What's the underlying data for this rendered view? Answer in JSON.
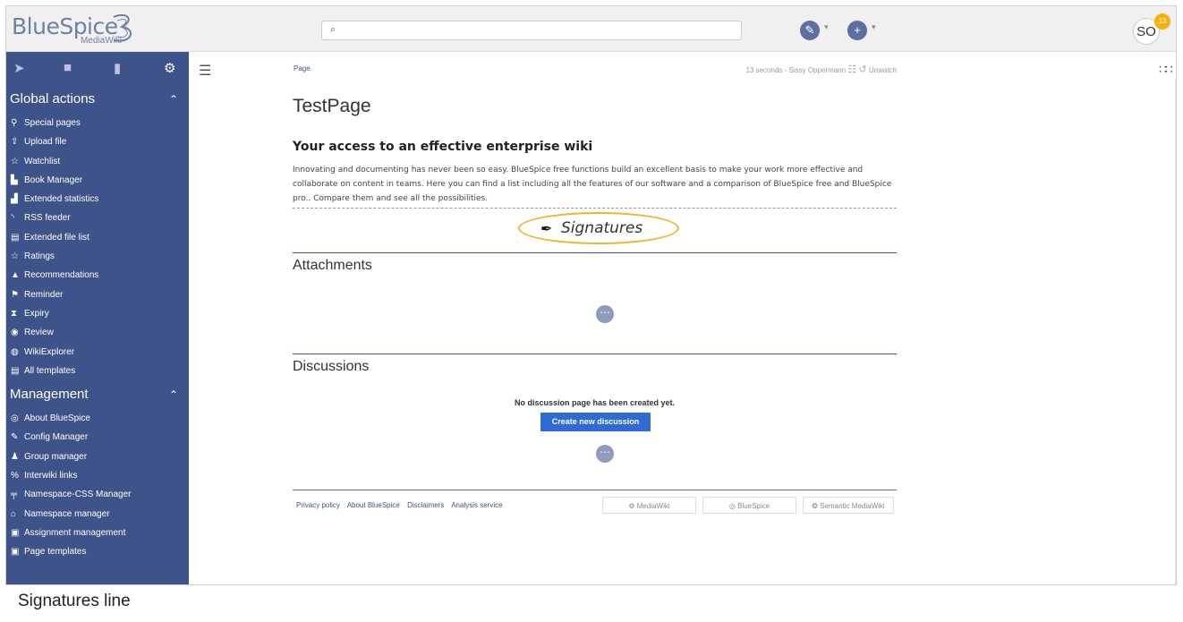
{
  "header": {
    "logo_main": "BlueSpice",
    "logo_sub": "MediaWiki",
    "search_placeholder": "",
    "avatar_initials": "SO",
    "notification_count": "13"
  },
  "sidebar": {
    "sections": [
      {
        "title": "Global actions",
        "items": [
          {
            "icon": "special-pages-icon",
            "glyph": "⚲",
            "label": "Special pages"
          },
          {
            "icon": "upload-icon",
            "glyph": "⇪",
            "label": "Upload file"
          },
          {
            "icon": "star-icon",
            "glyph": "☆",
            "label": "Watchlist"
          },
          {
            "icon": "book-icon",
            "glyph": "▙",
            "label": "Book Manager"
          },
          {
            "icon": "chart-icon",
            "glyph": "▟",
            "label": "Extended statistics"
          },
          {
            "icon": "rss-icon",
            "glyph": "◝",
            "label": "RSS feeder"
          },
          {
            "icon": "file-list-icon",
            "glyph": "▤",
            "label": "Extended file list"
          },
          {
            "icon": "star-icon",
            "glyph": "☆",
            "label": "Ratings"
          },
          {
            "icon": "thumbs-up-icon",
            "glyph": "▲",
            "label": "Recommendations"
          },
          {
            "icon": "flag-icon",
            "glyph": "⚑",
            "label": "Reminder"
          },
          {
            "icon": "hourglass-icon",
            "glyph": "⧗",
            "label": "Expiry"
          },
          {
            "icon": "eye-icon",
            "glyph": "◉",
            "label": "Review"
          },
          {
            "icon": "globe-icon",
            "glyph": "◍",
            "label": "WikiExplorer"
          },
          {
            "icon": "template-icon",
            "glyph": "▤",
            "label": "All templates"
          }
        ]
      },
      {
        "title": "Management",
        "items": [
          {
            "icon": "info-icon",
            "glyph": "◎",
            "label": "About BlueSpice"
          },
          {
            "icon": "wrench-icon",
            "glyph": "✎",
            "label": "Config Manager"
          },
          {
            "icon": "group-icon",
            "glyph": "♟",
            "label": "Group manager"
          },
          {
            "icon": "link-icon",
            "glyph": "%",
            "label": "Interwiki links"
          },
          {
            "icon": "paint-icon",
            "glyph": "╤",
            "label": "Namespace-CSS Manager"
          },
          {
            "icon": "namespace-icon",
            "glyph": "⌂",
            "label": "Namespace manager"
          },
          {
            "icon": "assignment-icon",
            "glyph": "▣",
            "label": "Assignment management"
          },
          {
            "icon": "page-templates-icon",
            "glyph": "▣",
            "label": "Page templates"
          }
        ]
      }
    ]
  },
  "content": {
    "breadcrumb": "Page",
    "last_edit": "13 seconds - Sissy Oppermann",
    "unwatch": "Unwatch",
    "title": "TestPage",
    "heading": "Your access to an effective enterprise wiki",
    "paragraph": "Innovating and documenting has never been so easy. BlueSpice free functions build an excellent basis to make your work more effective and collaborate on content in teams. Here you can find a list including all the features of our software and a comparison of BlueSpice free and BlueSpice pro.. Compare them and see all the possibilities.",
    "signatures": "Signatures",
    "attachments_title": "Attachments",
    "discussions_title": "Discussions",
    "no_discussion": "No discussion page has been created yet.",
    "create_discussion": "Create new discussion"
  },
  "footer": {
    "links": [
      "Privacy policy",
      "About BlueSpice",
      "Disclaimers",
      "Analysis service"
    ],
    "badges": [
      "MediaWiki",
      "BlueSpice",
      "Semantic MediaWiki"
    ]
  },
  "caption": "Signatures line",
  "colors": {
    "sidebar": "#3e5389",
    "accent_button": "#2e6bd6",
    "signature_highlight": "#f0b32a"
  }
}
